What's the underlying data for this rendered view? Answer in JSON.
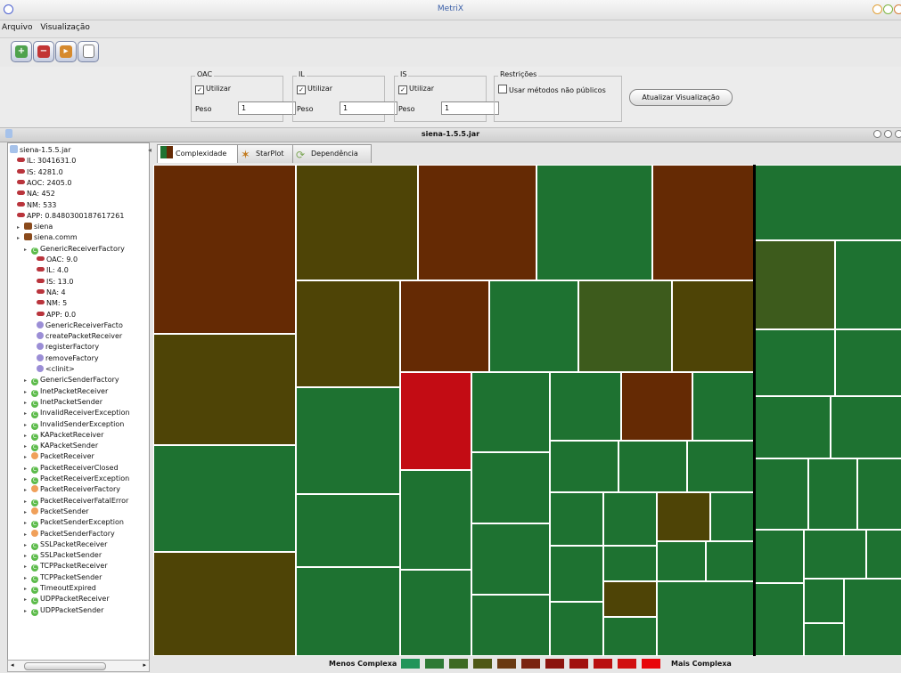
{
  "window": {
    "title": "MetriX"
  },
  "menu": [
    {
      "label": "Arquivo"
    },
    {
      "label": "Visualização"
    }
  ],
  "toolbar": [
    {
      "icon": "add-icon",
      "color": "#4fa24d",
      "glyph": "+"
    },
    {
      "icon": "remove-icon",
      "color": "#c23535",
      "glyph": "−"
    },
    {
      "icon": "expand-icon",
      "color": "#d68a2e",
      "glyph": "▸"
    },
    {
      "icon": "clipboard-icon",
      "color": "#8d8d8d",
      "glyph": ""
    }
  ],
  "options": {
    "oac": {
      "title": "OAC",
      "check_label": "Utilizar",
      "peso_label": "Peso",
      "peso_value": "1"
    },
    "il": {
      "title": "IL",
      "check_label": "Utilizar",
      "peso_label": "Peso",
      "peso_value": "1"
    },
    "is": {
      "title": "IS",
      "check_label": "Utilizar",
      "peso_label": "Peso",
      "peso_value": "1"
    },
    "restricoes": {
      "title": "Restrições",
      "check_label": "Usar métodos não públicos"
    },
    "update_button": "Atualizar Visualização"
  },
  "inner": {
    "title": "siena-1.5.5.jar"
  },
  "tree": [
    {
      "label": "siena-1.5.5.jar",
      "icon": "jar-icon",
      "level": 0
    },
    {
      "label": "IL: 3041631.0",
      "icon": "metric-icon",
      "level": 1
    },
    {
      "label": "IS: 4281.0",
      "icon": "metric-icon",
      "level": 1
    },
    {
      "label": "AOC: 2405.0",
      "icon": "metric-icon",
      "level": 1
    },
    {
      "label": "NA: 452",
      "icon": "metric-icon",
      "level": 1
    },
    {
      "label": "NM: 533",
      "icon": "metric-icon",
      "level": 1
    },
    {
      "label": "APP: 0.8480300187617261",
      "icon": "metric-icon",
      "level": 1
    },
    {
      "label": "siena",
      "icon": "package-icon",
      "level": 1
    },
    {
      "label": "siena.comm",
      "icon": "package-icon",
      "level": 1
    },
    {
      "label": "GenericReceiverFactory",
      "icon": "class-icon",
      "level": 2
    },
    {
      "label": "OAC: 9.0",
      "icon": "metric-icon",
      "level": 3
    },
    {
      "label": "IL: 4.0",
      "icon": "metric-icon",
      "level": 3
    },
    {
      "label": "IS: 13.0",
      "icon": "metric-icon",
      "level": 3
    },
    {
      "label": "NA: 4",
      "icon": "metric-icon",
      "level": 3
    },
    {
      "label": "NM: 5",
      "icon": "metric-icon",
      "level": 3
    },
    {
      "label": "APP: 0.0",
      "icon": "metric-icon",
      "level": 3
    },
    {
      "label": "GenericReceiverFacto",
      "icon": "method-icon",
      "level": 3
    },
    {
      "label": "createPacketReceiver",
      "icon": "method-icon",
      "level": 3
    },
    {
      "label": "registerFactory",
      "icon": "method-icon",
      "level": 3
    },
    {
      "label": "removeFactory",
      "icon": "method-icon",
      "level": 3
    },
    {
      "label": "<clinit>",
      "icon": "method-icon",
      "level": 3
    },
    {
      "label": "GenericSenderFactory",
      "icon": "class-icon",
      "level": 2
    },
    {
      "label": "InetPacketReceiver",
      "icon": "class-icon",
      "level": 2
    },
    {
      "label": "InetPacketSender",
      "icon": "class-icon",
      "level": 2
    },
    {
      "label": "InvalidReceiverException",
      "icon": "class-icon",
      "level": 2
    },
    {
      "label": "InvalidSenderException",
      "icon": "class-icon",
      "level": 2
    },
    {
      "label": "KAPacketReceiver",
      "icon": "class-icon",
      "level": 2
    },
    {
      "label": "KAPacketSender",
      "icon": "class-icon",
      "level": 2
    },
    {
      "label": "PacketReceiver",
      "icon": "interface-icon",
      "level": 2
    },
    {
      "label": "PacketReceiverClosed",
      "icon": "class-icon",
      "level": 2
    },
    {
      "label": "PacketReceiverException",
      "icon": "class-icon",
      "level": 2
    },
    {
      "label": "PacketReceiverFactory",
      "icon": "interface-icon",
      "level": 2
    },
    {
      "label": "PacketReceiverFatalError",
      "icon": "class-icon",
      "level": 2
    },
    {
      "label": "PacketSender",
      "icon": "interface-icon",
      "level": 2
    },
    {
      "label": "PacketSenderException",
      "icon": "class-icon",
      "level": 2
    },
    {
      "label": "PacketSenderFactory",
      "icon": "interface-icon",
      "level": 2
    },
    {
      "label": "SSLPacketReceiver",
      "icon": "class-icon",
      "level": 2
    },
    {
      "label": "SSLPacketSender",
      "icon": "class-icon",
      "level": 2
    },
    {
      "label": "TCPPacketReceiver",
      "icon": "class-icon",
      "level": 2
    },
    {
      "label": "TCPPacketSender",
      "icon": "class-icon",
      "level": 2
    },
    {
      "label": "TimeoutExpired",
      "icon": "class-icon",
      "level": 2
    },
    {
      "label": "UDPPacketReceiver",
      "icon": "class-icon",
      "level": 2
    },
    {
      "label": "UDPPacketSender",
      "icon": "class-icon",
      "level": 2
    }
  ],
  "tabs": [
    {
      "label": "Complexidade",
      "icon": "treemap-icon",
      "active": true
    },
    {
      "label": "StarPlot",
      "icon": "starplot-icon",
      "active": false
    },
    {
      "label": "Dependência",
      "icon": "dependency-icon",
      "active": false
    }
  ],
  "legend": {
    "less": "Menos Complexa",
    "more": "Mais Complexa",
    "colors": [
      "#22955a",
      "#2e7a35",
      "#3d6a22",
      "#4e5815",
      "#6a3a12",
      "#7a2410",
      "#8c140e",
      "#a1100e",
      "#b90f10",
      "#d10f10",
      "#e8060a"
    ]
  },
  "treemap_colors": {
    "g": "#1e7231",
    "o": "#3d5b1c",
    "y": "#4e4406",
    "b": "#652a04",
    "r": "#c30c14"
  }
}
